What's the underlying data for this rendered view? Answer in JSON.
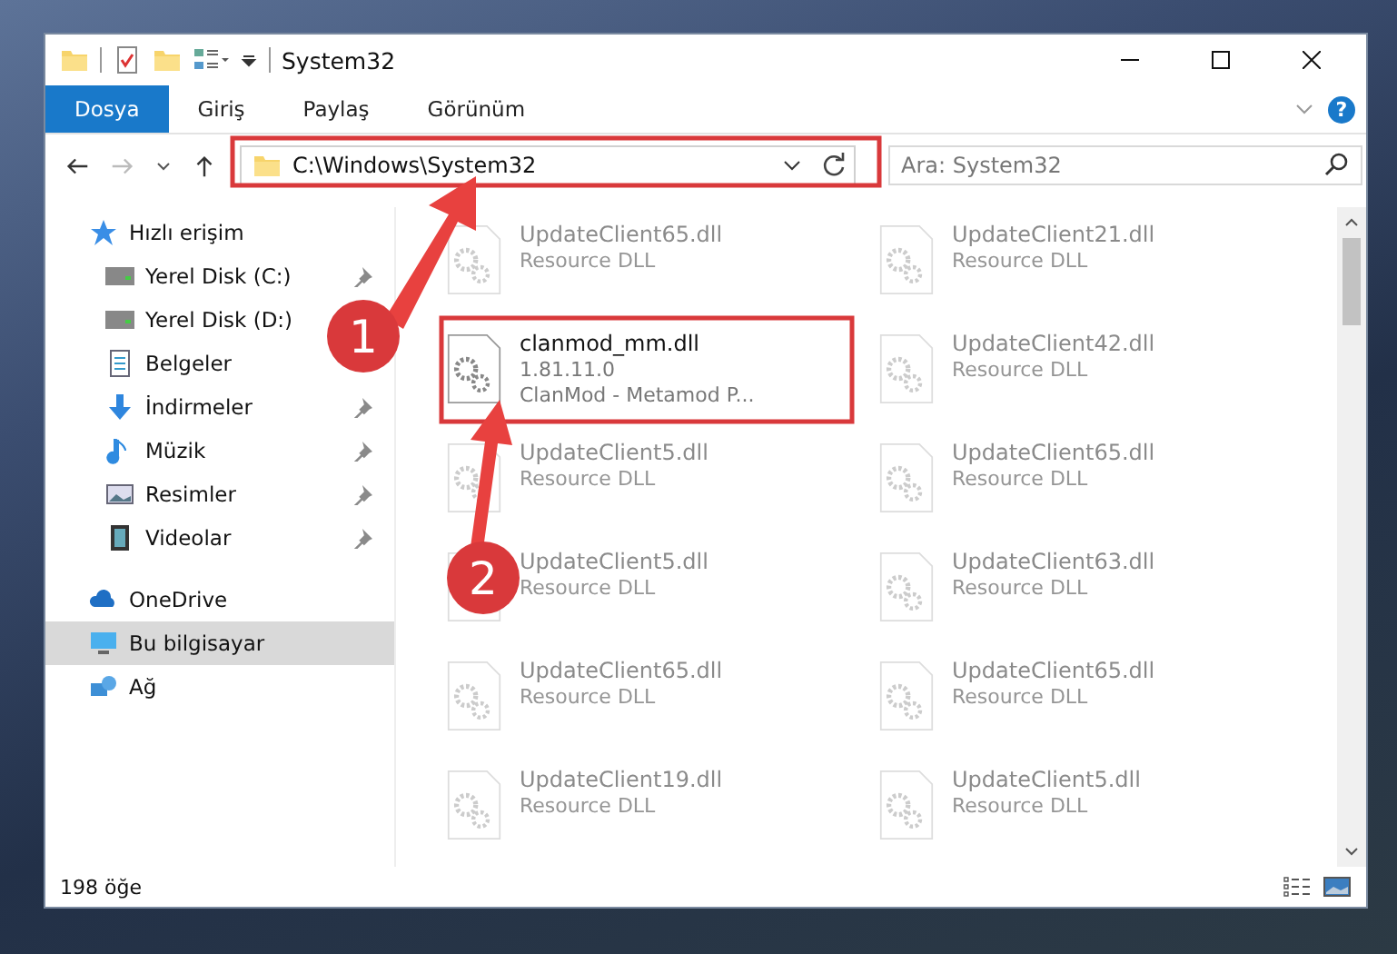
{
  "window": {
    "title": "System32"
  },
  "ribbon_tabs": [
    {
      "label": "Dosya",
      "selected": true
    },
    {
      "label": "Giriş",
      "selected": false
    },
    {
      "label": "Paylaş",
      "selected": false
    },
    {
      "label": "Görünüm",
      "selected": false
    }
  ],
  "help": "?",
  "address_bar": {
    "path": "C:\\Windows\\System32"
  },
  "search": {
    "placeholder": "Ara: System32"
  },
  "sidebar": {
    "items": [
      {
        "label": "Hızlı erişim",
        "kind": "quick",
        "selected": false,
        "children": [
          {
            "label": "Yerel Disk (C:)",
            "kind": "disk",
            "pinned": true
          },
          {
            "label": "Yerel Disk (D:)",
            "kind": "disk",
            "pinned": false
          },
          {
            "label": "Belgeler",
            "kind": "docs",
            "pinned": false
          },
          {
            "label": "İndirmeler",
            "kind": "downloads",
            "pinned": true
          },
          {
            "label": "Müzik",
            "kind": "music",
            "pinned": true
          },
          {
            "label": "Resimler",
            "kind": "pictures",
            "pinned": true
          },
          {
            "label": "Videolar",
            "kind": "videos",
            "pinned": true
          }
        ]
      },
      {
        "label": "OneDrive",
        "kind": "cloud",
        "selected": false
      },
      {
        "label": "Bu bilgisayar",
        "kind": "computer",
        "selected": true
      },
      {
        "label": "Ağ",
        "kind": "network",
        "selected": false
      }
    ]
  },
  "files": [
    {
      "name": "UpdateClient65.dll",
      "lines": [
        "Resource DLL"
      ],
      "faded": true
    },
    {
      "name": "UpdateClient21.dll",
      "lines": [
        "Resource DLL"
      ],
      "faded": true
    },
    {
      "name": "clanmod_mm.dll",
      "lines": [
        "1.81.11.0",
        "ClanMod - Metamod P..."
      ],
      "faded": false
    },
    {
      "name": "UpdateClient42.dll",
      "lines": [
        "Resource DLL"
      ],
      "faded": true
    },
    {
      "name": "UpdateClient5.dll",
      "lines": [
        "Resource DLL"
      ],
      "faded": true
    },
    {
      "name": "UpdateClient65.dll",
      "lines": [
        "Resource DLL"
      ],
      "faded": true
    },
    {
      "name": "UpdateClient5.dll",
      "lines": [
        "Resource DLL"
      ],
      "faded": true
    },
    {
      "name": "UpdateClient63.dll",
      "lines": [
        "Resource DLL"
      ],
      "faded": true
    },
    {
      "name": "UpdateClient65.dll",
      "lines": [
        "Resource DLL"
      ],
      "faded": true
    },
    {
      "name": "UpdateClient65.dll",
      "lines": [
        "Resource DLL"
      ],
      "faded": true
    },
    {
      "name": "UpdateClient19.dll",
      "lines": [
        "Resource DLL"
      ],
      "faded": true
    },
    {
      "name": "UpdateClient5.dll",
      "lines": [
        "Resource DLL"
      ],
      "faded": true
    }
  ],
  "status_bar": {
    "count": "198 öğe"
  },
  "annotations": [
    {
      "number": "1"
    },
    {
      "number": "2"
    }
  ]
}
